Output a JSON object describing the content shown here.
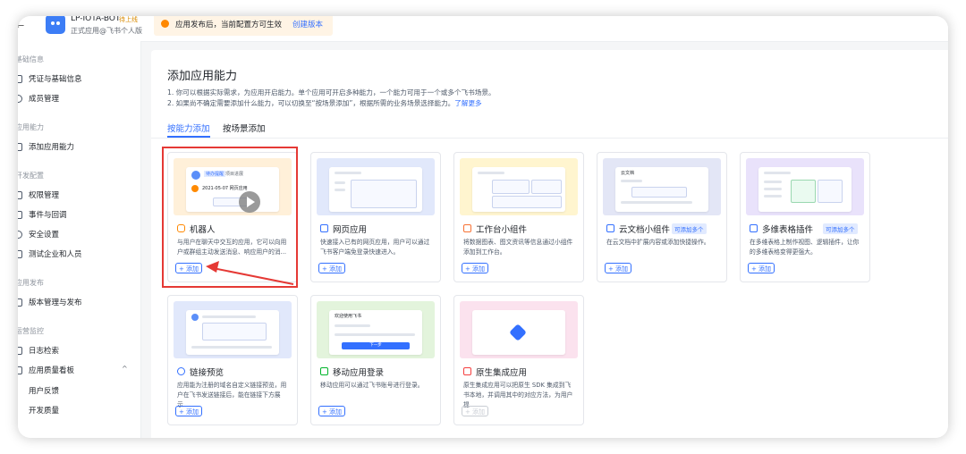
{
  "header": {
    "back_glyph": "←",
    "app_name": "LP-IOTA-BOT",
    "app_status": "待上线",
    "app_subtitle": "正式应用@飞书个人版",
    "notice_text": "应用发布后，当前配置方可生效",
    "notice_link": "创建版本"
  },
  "sidebar": {
    "group_basic": "基础信息",
    "item_credentials": "凭证与基础信息",
    "item_members": "成员管理",
    "group_ability": "应用能力",
    "item_add_ability": "添加应用能力",
    "group_dev": "开发配置",
    "item_permissions": "权限管理",
    "item_events": "事件与回调",
    "item_security": "安全设置",
    "item_test": "测试企业和人员",
    "group_release": "应用发布",
    "item_versions": "版本管理与发布",
    "group_ops": "运营监控",
    "item_logs": "日志检索",
    "item_quality": "应用质量看板",
    "item_feedback": "用户反馈",
    "item_dev_quality": "开发质量",
    "chevron": "^"
  },
  "main": {
    "title": "添加应用能力",
    "desc_line1": "1. 你可以根据实际需求，为应用开启能力。单个应用可开启多种能力，一个能力可用于一个或多个飞书场景。",
    "desc_line2": "2. 如果尚不确定需要添加什么能力，可以切换至“按场景添加”，根据所需的业务场景选择能力。",
    "desc_link": "了解更多",
    "tab_by_ability": "按能力添加",
    "tab_by_scene": "按场景添加"
  },
  "cards": {
    "add_label": "+ 添加",
    "bot": {
      "title": "机器人",
      "desc": "与用户在聊天中交互的应用，它可以向用户或群组主动发送消息、响应用户的消...",
      "mock_tag": "待办提醒",
      "mock_tag2": "项目进展",
      "mock_date": "2021-05-07 网页应用"
    },
    "web": {
      "title": "网页应用",
      "desc": "快速接入已有的网页应用，用户可以通过飞书客户端免登录快速进入。"
    },
    "widget": {
      "title": "工作台小组件",
      "desc": "将数据图表、图文资讯等信息通过小组件添加到工作台。"
    },
    "doc_widget": {
      "title": "云文档小组件",
      "badge": "可添加多个",
      "desc": "在云文档中扩展内容或添加快捷操作。",
      "mock_title": "云文档"
    },
    "bitable": {
      "title": "多维表格插件",
      "badge": "可添加多个",
      "desc": "在多维表格上制作视图、逻辑插件，让你的多维表格变得更强大。"
    },
    "link_preview": {
      "title": "链接预览",
      "desc": "应用能为注册的域名自定义链接预览，用户在飞书发送链接后，能在链接下方展示..."
    },
    "mobile_login": {
      "title": "移动应用登录",
      "desc": "移动应用可以通过飞书账号进行登录。",
      "mock_title": "欢迎使用飞书",
      "mock_btn": "下一步"
    },
    "native": {
      "title": "原生集成应用",
      "desc": "原生集成应用可以把原生 SDK 集成到飞书本地，并调用其中的对应方法，为用户提..."
    }
  },
  "colors": {
    "accent": "#3370ff",
    "highlight": "#e53935",
    "notice_bg": "#fff4e5"
  }
}
